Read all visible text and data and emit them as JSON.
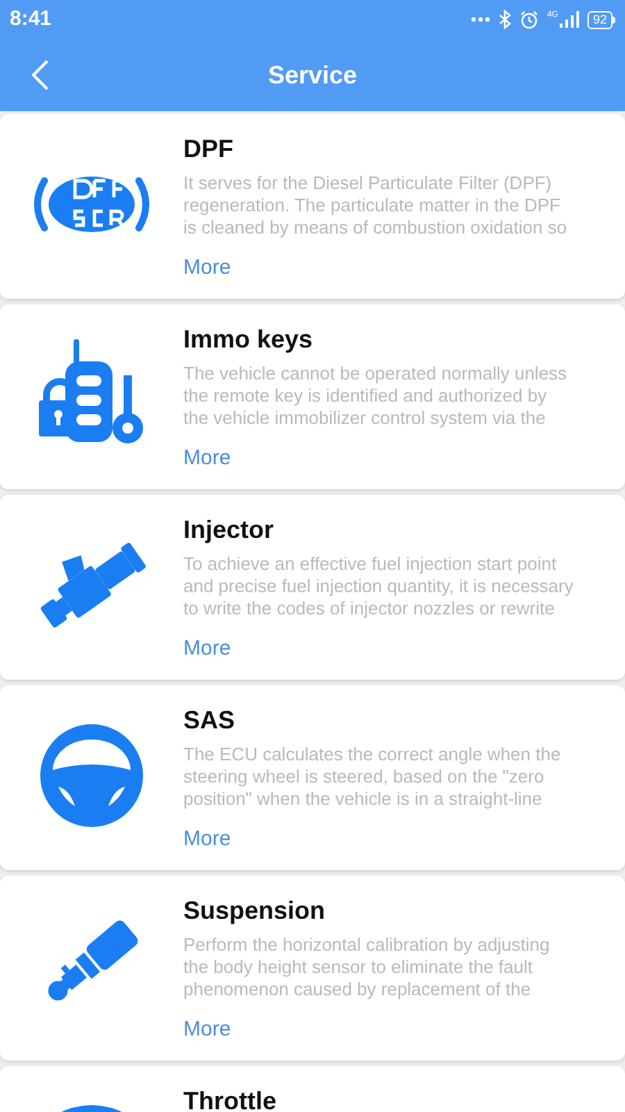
{
  "status_bar": {
    "time": "8:41",
    "network": "4G",
    "battery": "92"
  },
  "header": {
    "title": "Service"
  },
  "services": [
    {
      "kind": "dpf",
      "title": "DPF",
      "description": [
        "It serves for the Diesel Particulate Filter (DPF)",
        "regeneration. The particulate matter in the DPF",
        "is cleaned by means of combustion oxidation so"
      ],
      "link": "More"
    },
    {
      "kind": "immo",
      "title": "Immo keys",
      "description": [
        "The vehicle cannot be operated normally unless",
        "the remote key is identified and authorized by",
        "the vehicle immobilizer control system via the"
      ],
      "link": "More"
    },
    {
      "kind": "injector",
      "title": "Injector",
      "description": [
        "To achieve an effective fuel injection start point",
        "and precise fuel injection quantity, it is necessary",
        "to write the codes of injector nozzles or rewrite"
      ],
      "link": "More"
    },
    {
      "kind": "sas",
      "title": "SAS",
      "description": [
        "The ECU calculates the correct angle when the",
        "steering wheel is steered, based on the \"zero",
        "position\" when the vehicle is in a straight-line"
      ],
      "link": "More"
    },
    {
      "kind": "suspension",
      "title": "Suspension",
      "description": [
        "Perform the horizontal calibration by adjusting",
        "the body height sensor to eliminate the fault",
        "phenomenon caused by replacement of the"
      ],
      "link": "More"
    },
    {
      "kind": "throttle",
      "title": "Throttle"
    }
  ]
}
